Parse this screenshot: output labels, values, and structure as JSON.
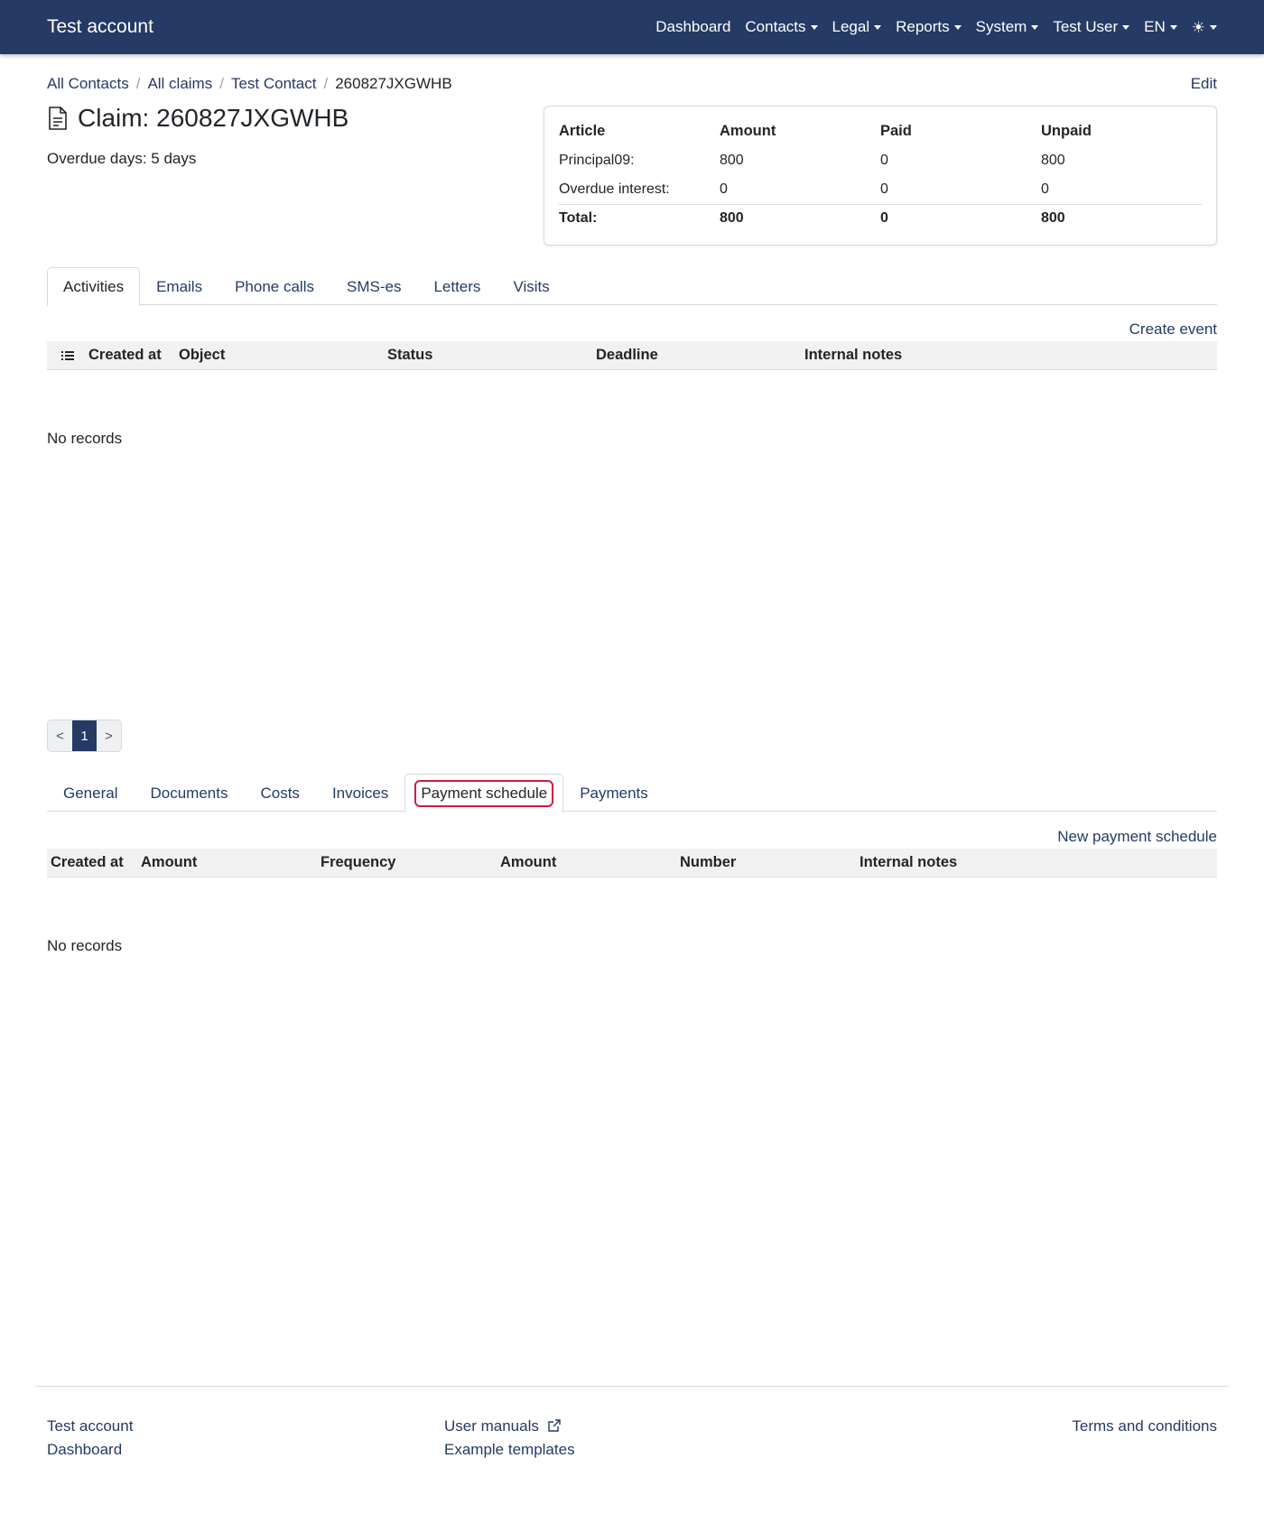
{
  "navbar": {
    "brand": "Test account",
    "items": [
      {
        "label": "Dashboard",
        "dropdown": false
      },
      {
        "label": "Contacts",
        "dropdown": true
      },
      {
        "label": "Legal",
        "dropdown": true
      },
      {
        "label": "Reports",
        "dropdown": true
      },
      {
        "label": "System",
        "dropdown": true
      },
      {
        "label": "Test User",
        "dropdown": true
      },
      {
        "label": "EN",
        "dropdown": true
      }
    ],
    "theme_icon": "☀"
  },
  "breadcrumb": [
    "All Contacts",
    "All claims",
    "Test Contact",
    "260827JXGWHB"
  ],
  "edit_label": "Edit",
  "claim": {
    "title": "Claim: 260827JXGWHB",
    "overdue": "Overdue days: 5 days"
  },
  "summary": {
    "headers": [
      "Article",
      "Amount",
      "Paid",
      "Unpaid"
    ],
    "rows": [
      [
        "Principal09:",
        "800",
        "0",
        "800"
      ],
      [
        "Overdue interest:",
        "0",
        "0",
        "0"
      ]
    ],
    "total": [
      "Total:",
      "800",
      "0",
      "800"
    ]
  },
  "activity_tabs": [
    "Activities",
    "Emails",
    "Phone calls",
    "SMS-es",
    "Letters",
    "Visits"
  ],
  "activity_action": "Create event",
  "activity_columns": [
    "Created at",
    "Object",
    "Status",
    "Deadline",
    "Internal notes"
  ],
  "activity_empty": "No records",
  "pagination": {
    "prev": "<",
    "page": "1",
    "next": ">"
  },
  "claim_tabs": [
    "General",
    "Documents",
    "Costs",
    "Invoices",
    "Payment schedule",
    "Payments"
  ],
  "schedule_action": "New payment schedule",
  "schedule_columns": [
    "Created at",
    "Amount",
    "Frequency",
    "Amount",
    "Number",
    "Internal notes"
  ],
  "schedule_empty": "No records",
  "footer": {
    "col1": [
      "Test account",
      "Dashboard"
    ],
    "col2": [
      "User manuals",
      "Example templates"
    ],
    "col3": [
      "Terms and conditions"
    ]
  }
}
